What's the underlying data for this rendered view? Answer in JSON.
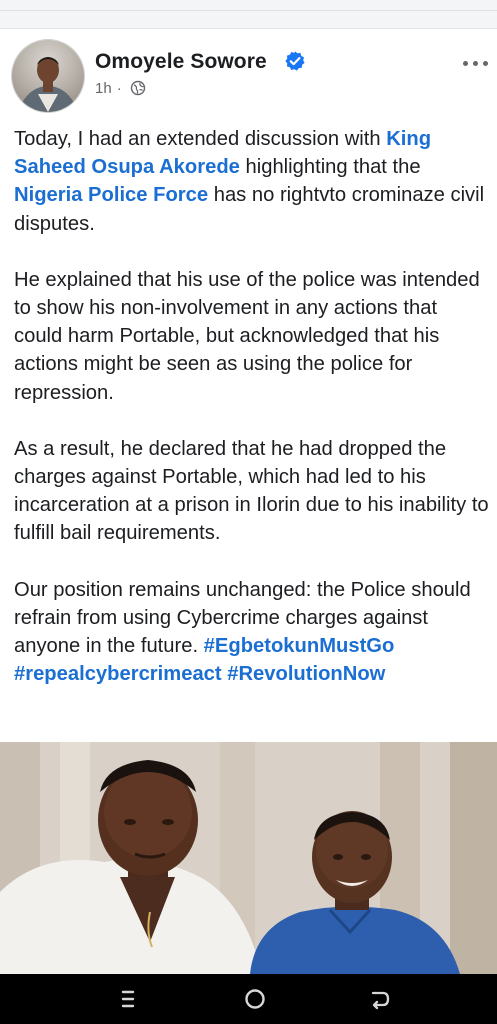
{
  "post": {
    "author": "Omoyele Sowore",
    "time": "1h",
    "separator": "·",
    "paragraphs": [
      [
        {
          "text": "Today, I had an extended discussion with "
        },
        {
          "text": "King Saheed Osupa Akorede",
          "link": true
        },
        {
          "text": " highlighting that the "
        },
        {
          "text": "Nigeria Police Force",
          "link": true
        },
        {
          "text": " has no rightvto crominaze civil disputes."
        }
      ],
      [
        {
          "text": "He explained that his use of the police was intended to show his non-involvement in any actions that could harm Portable, but acknowledged that his actions might be seen as using the police for repression."
        }
      ],
      [
        {
          "text": "As a result, he declared that he had dropped the charges against Portable, which had led to his incarceration at a prison in Ilorin due to his inability to fulfill bail requirements."
        }
      ],
      [
        {
          "text": "Our position remains unchanged: the Police should refrain from using Cybercrime charges against anyone in the future. "
        },
        {
          "text": "#EgbetokunMustGo",
          "hashtag": true
        },
        {
          "text": " "
        },
        {
          "text": "#repealcybercrimeact",
          "hashtag": true
        },
        {
          "text": " "
        },
        {
          "text": "#RevolutionNow",
          "hashtag": true
        }
      ]
    ]
  },
  "icons": {
    "verified": "verified-badge-icon",
    "audience": "globe-icon",
    "more": "more-options-icon",
    "nav_menu": "recent-apps-icon",
    "nav_home": "home-icon",
    "nav_back": "back-icon"
  },
  "colors": {
    "link": "#1b6fd3",
    "verified": "#1877f2",
    "meta_text": "#65676b",
    "nav_bar": "#000000"
  }
}
